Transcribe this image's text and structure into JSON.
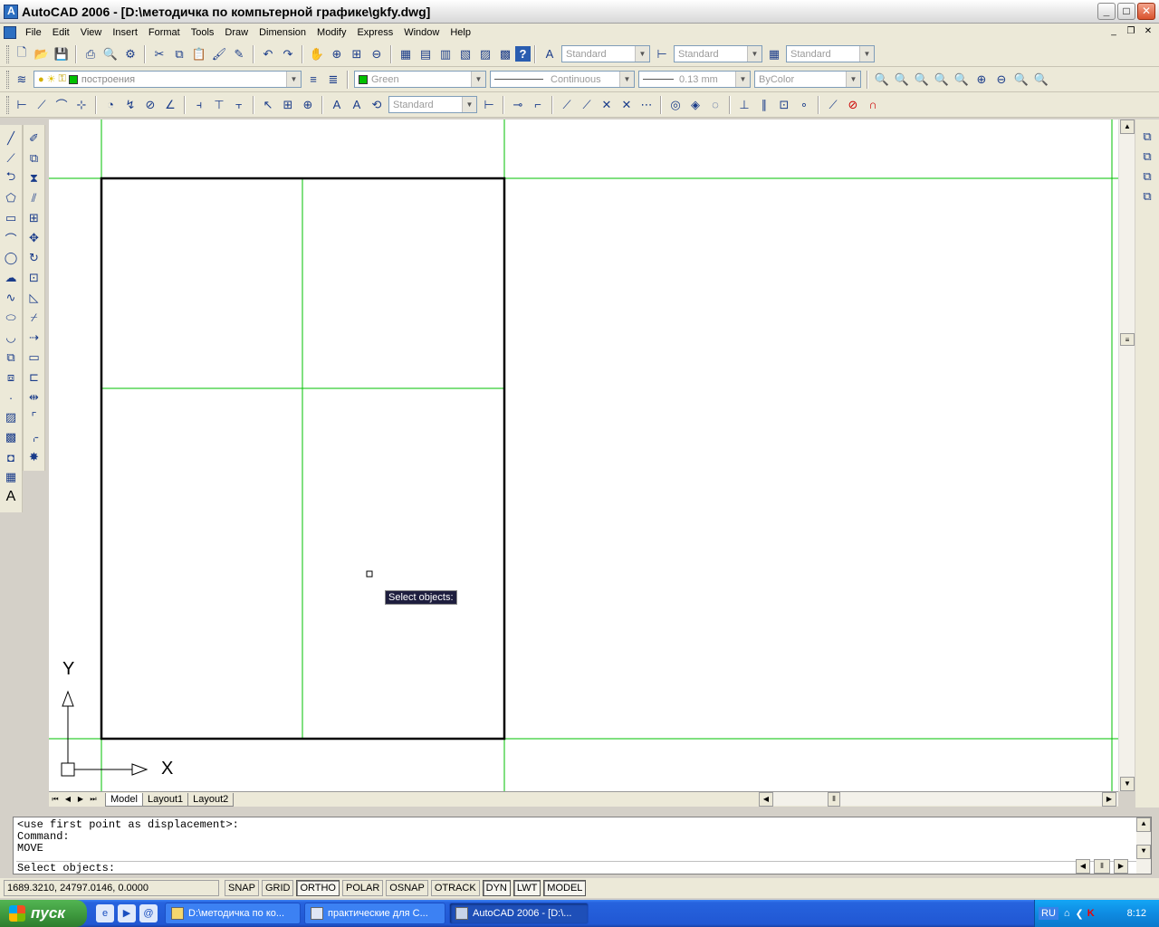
{
  "window": {
    "title": "AutoCAD 2006 - [D:\\методичка по компьтерной графике\\gkfy.dwg]",
    "min_label": "_",
    "max_label": "□",
    "close_label": "✕"
  },
  "menu": {
    "items": [
      "File",
      "Edit",
      "View",
      "Insert",
      "Format",
      "Tools",
      "Draw",
      "Dimension",
      "Modify",
      "Express",
      "Window",
      "Help"
    ],
    "mdi_min": "_",
    "mdi_restore": "❐",
    "mdi_close": "✕"
  },
  "styles_toolbar": {
    "text_style": "Standard",
    "dim_style": "Standard",
    "table_style": "Standard"
  },
  "layers_toolbar": {
    "layer_name": "построения",
    "color_name": "Green",
    "color_hex": "#00c000",
    "linetype": "Continuous",
    "lineweight": "0.13 mm",
    "plotstyle": "ByColor"
  },
  "dim_toolbar": {
    "dim_style": "Standard"
  },
  "drawing": {
    "tooltip": "Select objects:",
    "ucs_x": "X",
    "ucs_y": "Y"
  },
  "tabs": [
    "Model",
    "Layout1",
    "Layout2"
  ],
  "command_line": {
    "lines": [
      "<use first point as displacement>:",
      "Command:",
      "MOVE"
    ],
    "prompt": "Select objects:"
  },
  "status": {
    "coordinates": "1689.3210, 24797.0146, 0.0000",
    "buttons": [
      {
        "label": "SNAP",
        "on": false
      },
      {
        "label": "GRID",
        "on": false
      },
      {
        "label": "ORTHO",
        "on": true
      },
      {
        "label": "POLAR",
        "on": false
      },
      {
        "label": "OSNAP",
        "on": false
      },
      {
        "label": "OTRACK",
        "on": false
      },
      {
        "label": "DYN",
        "on": true
      },
      {
        "label": "LWT",
        "on": true
      },
      {
        "label": "MODEL",
        "on": true
      }
    ]
  },
  "taskbar": {
    "start_label": "пуск",
    "tasks": [
      {
        "label": "D:\\методичка по ко...",
        "active": false
      },
      {
        "label": "практические для С...",
        "active": false
      },
      {
        "label": "AutoCAD 2006 - [D:\\...",
        "active": true
      }
    ],
    "lang": "RU",
    "clock": "8:12"
  }
}
